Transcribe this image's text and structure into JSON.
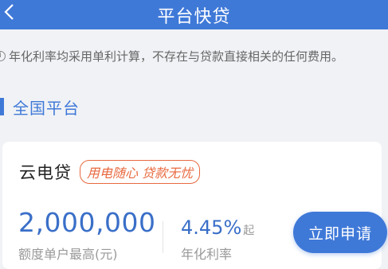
{
  "header": {
    "title": "平台快贷"
  },
  "notice": {
    "text": "年化利率均采用单利计算，不存在与贷款直接相关的任何费用。"
  },
  "section": {
    "title": "全国平台"
  },
  "card": {
    "product_name": "云电贷",
    "slogan": "用电随心 贷款无忧",
    "amount": "2,000,000",
    "amount_label": "额度单户最高(元)",
    "rate": "4.45%",
    "rate_suffix": "起",
    "rate_label": "年化利率"
  },
  "actions": {
    "apply_label": "立即申请"
  },
  "colors": {
    "primary": "#3f79d8",
    "slogan": "#e8693f",
    "background": "#f0f2f5"
  }
}
